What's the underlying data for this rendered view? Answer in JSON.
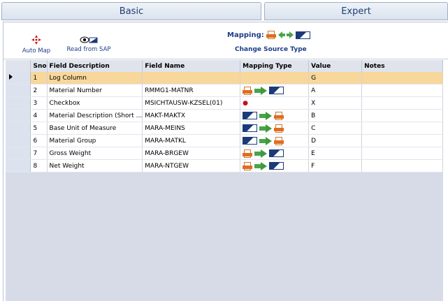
{
  "tabs": {
    "basic": "Basic",
    "expert": "Expert"
  },
  "toolbar": {
    "auto_map": "Auto Map",
    "read_from_sap": "Read from SAP",
    "mapping_label": "Mapping:",
    "change_source_type": "Change Source Type"
  },
  "grid": {
    "columns": {
      "sno": "Sno",
      "field_description": "Field Description",
      "field_name": "Field Name",
      "mapping_type": "Mapping Type",
      "value": "Value",
      "notes": "Notes"
    },
    "rows": [
      {
        "sno": "1",
        "desc": "Log Column",
        "name": "",
        "mapping": "none",
        "value": "G",
        "notes": ""
      },
      {
        "sno": "2",
        "desc": "Material Number",
        "name": "RMMG1-MATNR",
        "mapping": "xml-to-table",
        "value": "A",
        "notes": ""
      },
      {
        "sno": "3",
        "desc": "Checkbox",
        "name": "MSICHTAUSW-KZSEL(01)",
        "mapping": "pin",
        "value": "X",
        "notes": ""
      },
      {
        "sno": "4",
        "desc": "Material Description (Short ...",
        "name": "MAKT-MAKTX",
        "mapping": "table-to-xml",
        "value": "B",
        "notes": ""
      },
      {
        "sno": "5",
        "desc": "Base Unit of Measure",
        "name": "MARA-MEINS",
        "mapping": "table-to-xml",
        "value": "C",
        "notes": ""
      },
      {
        "sno": "6",
        "desc": "Material Group",
        "name": "MARA-MATKL",
        "mapping": "table-to-xml",
        "value": "D",
        "notes": ""
      },
      {
        "sno": "7",
        "desc": "Gross Weight",
        "name": "MARA-BRGEW",
        "mapping": "xml-to-table",
        "value": "E",
        "notes": ""
      },
      {
        "sno": "8",
        "desc": "Net Weight",
        "name": "MARA-NTGEW",
        "mapping": "xml-to-table",
        "value": "F",
        "notes": ""
      }
    ]
  }
}
